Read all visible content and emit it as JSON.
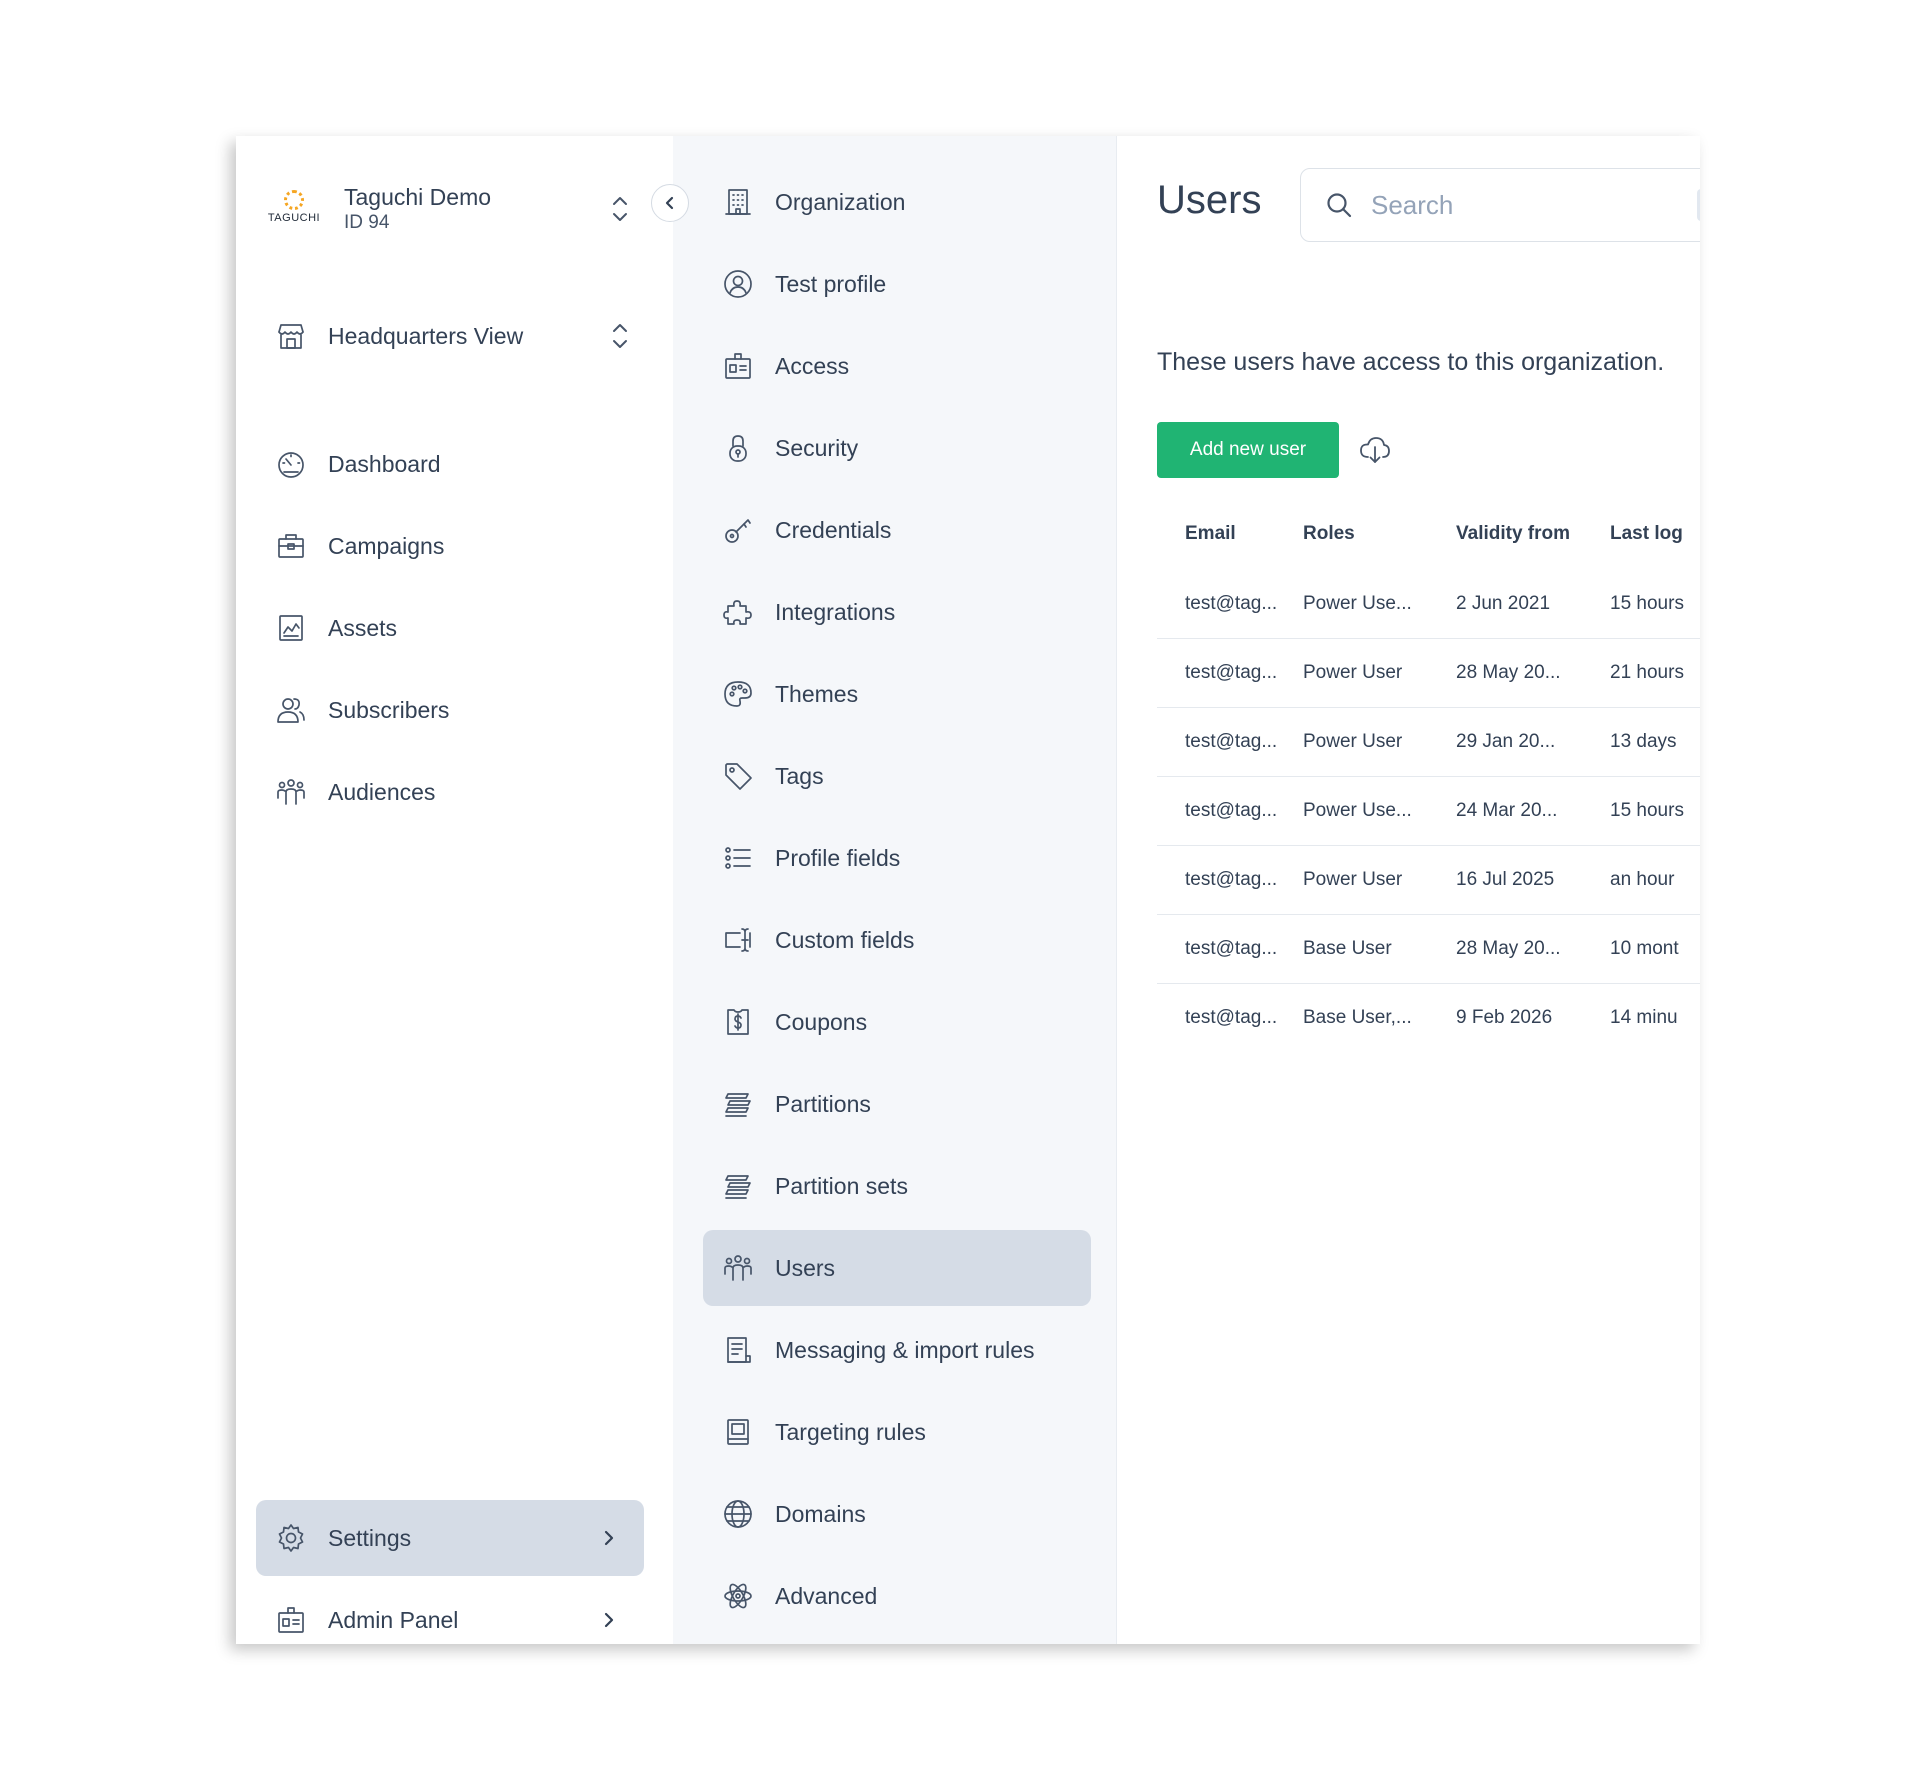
{
  "org": {
    "logo_text": "TAGUCHI",
    "name": "Taguchi Demo",
    "id": "ID 94"
  },
  "view": {
    "label": "Headquarters View"
  },
  "nav": {
    "items": [
      {
        "label": "Dashboard",
        "icon": "dashboard-icon"
      },
      {
        "label": "Campaigns",
        "icon": "briefcase-icon"
      },
      {
        "label": "Assets",
        "icon": "image-icon"
      },
      {
        "label": "Subscribers",
        "icon": "users-icon"
      },
      {
        "label": "Audiences",
        "icon": "audience-icon"
      }
    ],
    "settings": "Settings",
    "admin": "Admin Panel"
  },
  "submenu": {
    "items": [
      {
        "label": "Organization",
        "icon": "building-icon"
      },
      {
        "label": "Test profile",
        "icon": "user-circle-icon"
      },
      {
        "label": "Access",
        "icon": "id-badge-icon"
      },
      {
        "label": "Security",
        "icon": "lock-icon"
      },
      {
        "label": "Credentials",
        "icon": "key-icon"
      },
      {
        "label": "Integrations",
        "icon": "puzzle-icon"
      },
      {
        "label": "Themes",
        "icon": "palette-icon"
      },
      {
        "label": "Tags",
        "icon": "tag-icon"
      },
      {
        "label": "Profile fields",
        "icon": "list-icon"
      },
      {
        "label": "Custom fields",
        "icon": "text-cursor-icon"
      },
      {
        "label": "Coupons",
        "icon": "coupon-icon"
      },
      {
        "label": "Partitions",
        "icon": "stack-icon"
      },
      {
        "label": "Partition sets",
        "icon": "stack-icon"
      },
      {
        "label": "Users",
        "icon": "audience-icon",
        "active": true
      },
      {
        "label": "Messaging & import rules",
        "icon": "document-icon"
      },
      {
        "label": "Targeting rules",
        "icon": "book-icon"
      },
      {
        "label": "Domains",
        "icon": "globe-icon"
      },
      {
        "label": "Advanced",
        "icon": "atom-icon"
      }
    ]
  },
  "main": {
    "title": "Users",
    "search": {
      "placeholder": "Search",
      "shortcut": "⌘"
    },
    "intro": "These users have access to this organization.",
    "add_button": "Add new user",
    "table": {
      "columns": [
        "Email",
        "Roles",
        "Validity from",
        "Last log"
      ],
      "rows": [
        [
          "test@tag...",
          "Power Use...",
          "2 Jun 2021",
          "15 hours"
        ],
        [
          "test@tag...",
          "Power User",
          "28 May 20...",
          "21 hours"
        ],
        [
          "test@tag...",
          "Power User",
          "29 Jan 20...",
          "13 days"
        ],
        [
          "test@tag...",
          "Power Use...",
          "24 Mar 20...",
          "15 hours"
        ],
        [
          "test@tag...",
          "Power User",
          "16 Jul 2025",
          "an hour"
        ],
        [
          "test@tag...",
          "Base User",
          "28 May 20...",
          "10 mont"
        ],
        [
          "test@tag...",
          "Base User,...",
          "9 Feb 2026",
          "14 minu"
        ]
      ]
    }
  },
  "colors": {
    "accent": "#20b473",
    "active_bg": "#d5dce6",
    "submenu_bg": "#f5f7fa",
    "text": "#334155"
  }
}
